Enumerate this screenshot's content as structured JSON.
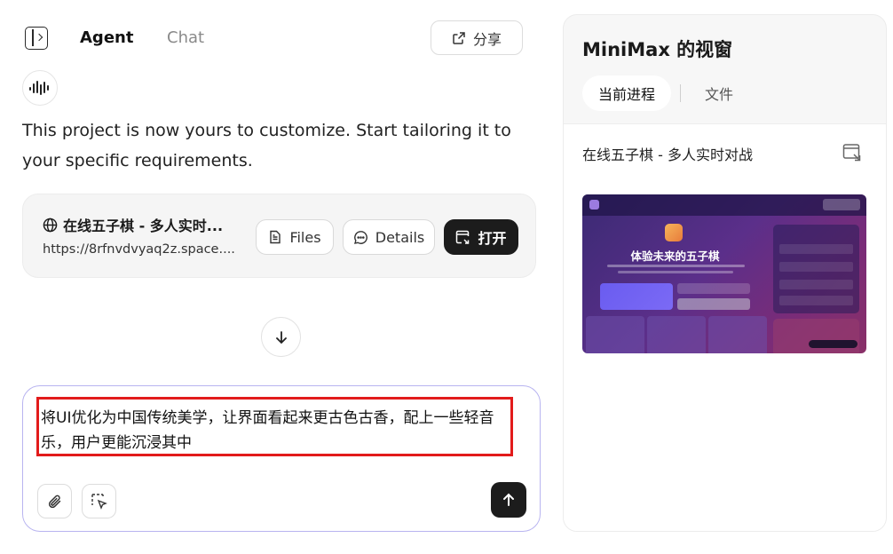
{
  "header": {
    "tabs": [
      "Agent",
      "Chat"
    ],
    "share_label": "分享"
  },
  "message": {
    "text": "This project is now yours to customize. Start tailoring it to your specific requirements."
  },
  "project_card": {
    "title": "在线五子棋 - 多人实时...",
    "url": "https://8rfnvdvyaq2z.space....",
    "files_label": "Files",
    "details_label": "Details",
    "open_label": "打开"
  },
  "composer": {
    "text": "将UI优化为中国传统美学，让界面看起来更古色古香，配上一些轻音乐，用户更能沉浸其中"
  },
  "panel": {
    "title": "MiniMax 的视窗",
    "tabs": [
      "当前进程",
      "文件"
    ],
    "item_title": "在线五子棋 - 多人实时对战",
    "preview": {
      "headline": "体验未来的五子棋"
    }
  },
  "colors": {
    "accent_dark": "#1c1c1c",
    "composer_border": "#b8b4f0",
    "highlight_red": "#e21b1b"
  }
}
